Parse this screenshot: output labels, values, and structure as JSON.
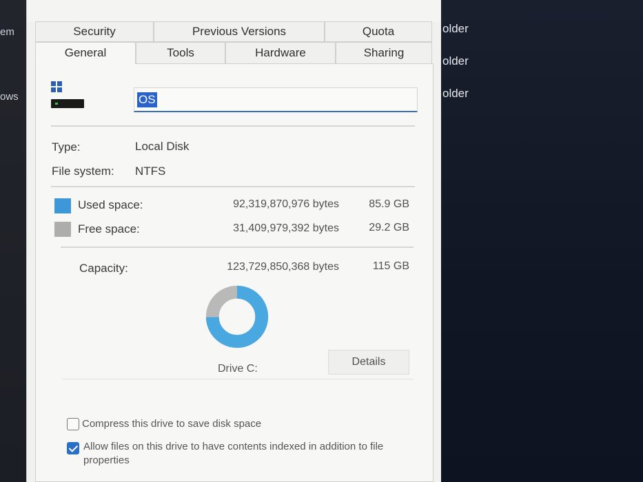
{
  "desktop": {
    "left_labels": [
      "em",
      "ows"
    ],
    "right_labels": [
      "older",
      "older",
      "older"
    ]
  },
  "tabs": {
    "row1": [
      "Security",
      "Previous Versions",
      "Quota"
    ],
    "row2": [
      "General",
      "Tools",
      "Hardware",
      "Sharing"
    ],
    "active": "General"
  },
  "drive": {
    "name_value": "OS",
    "icon": "drive-icon"
  },
  "info": {
    "type_label": "Type:",
    "type_value": "Local Disk",
    "fs_label": "File system:",
    "fs_value": "NTFS"
  },
  "space": {
    "used_label": "Used space:",
    "used_bytes": "92,319,870,976 bytes",
    "used_gb": "85.9 GB",
    "free_label": "Free space:",
    "free_bytes": "31,409,979,392 bytes",
    "free_gb": "29.2 GB",
    "capacity_label": "Capacity:",
    "capacity_bytes": "123,729,850,368 bytes",
    "capacity_gb": "115 GB",
    "used_fraction": 0.746,
    "used_color": "#4aa8e0",
    "free_color": "#b9b9b9"
  },
  "chart": {
    "drive_label": "Drive C:",
    "details_button": "Details"
  },
  "options": {
    "compress_label": "Compress this drive to save disk space",
    "compress_checked": false,
    "index_label": "Allow files on this drive to have contents indexed in addition to file properties",
    "index_checked": true
  }
}
